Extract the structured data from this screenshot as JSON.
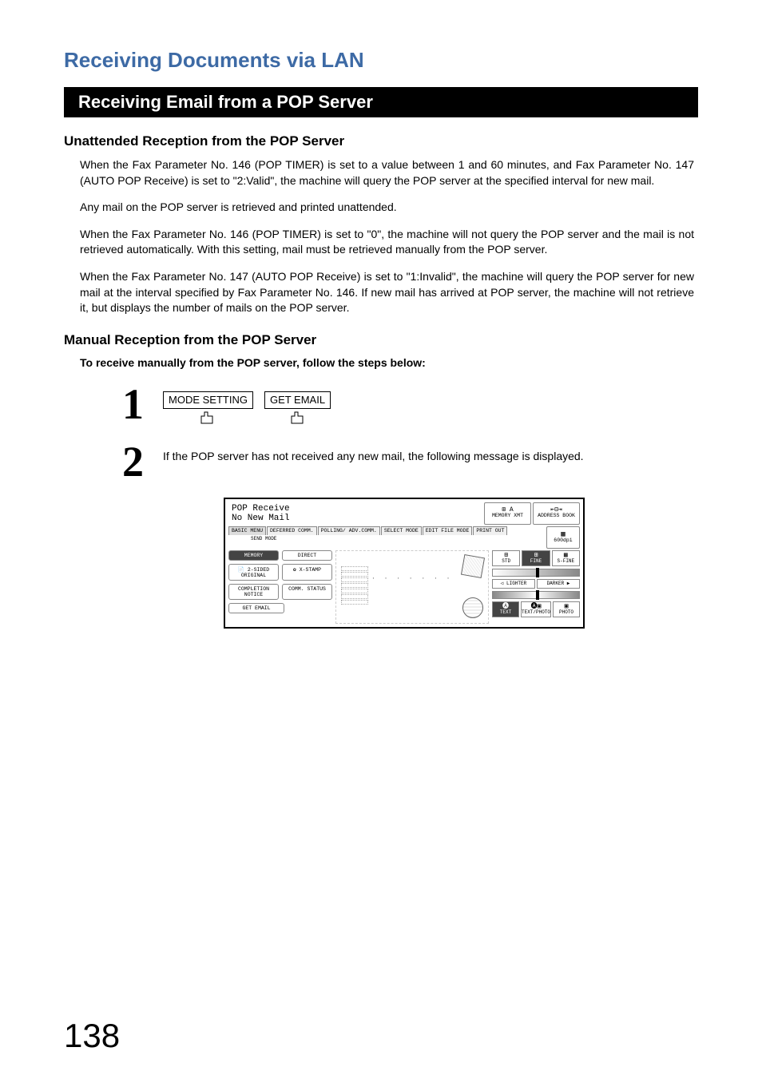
{
  "chapter_title": "Receiving Documents via LAN",
  "section_title": "Receiving Email from a POP Server",
  "sub1": {
    "heading": "Unattended Reception from the POP Server",
    "para1": "When the Fax Parameter No. 146 (POP TIMER) is set to a value between 1 and 60 minutes, and Fax Parameter No. 147 (AUTO POP Receive) is set to \"2:Valid\", the machine will query the POP server at the specified interval for new mail.",
    "para2": "Any mail on the POP server is retrieved and printed unattended.",
    "para3": "When the Fax Parameter No. 146 (POP TIMER) is set to \"0\", the machine will not query the POP server and the mail is not retrieved automatically.  With this setting, mail must be retrieved manually from the POP server.",
    "para4": "When the Fax Parameter No. 147 (AUTO POP Receive) is set to \"1:Invalid\", the machine will query the POP server for new mail at the interval specified by Fax Parameter No. 146.  If new mail has arrived at POP server, the machine will not retrieve it, but displays the number of mails on the POP server."
  },
  "sub2": {
    "heading": "Manual Reception from the POP Server",
    "instruction": "To receive manually from the POP server, follow the steps below:",
    "step1": {
      "num": "1",
      "btn1": "MODE SETTING",
      "btn2": "GET EMAIL"
    },
    "step2": {
      "num": "2",
      "text": "If the POP server has not received any new mail, the following message is displayed."
    }
  },
  "lcd": {
    "status_line1": "POP Receive",
    "status_line2": "No New Mail",
    "top_btn1": "MEMORY XMT",
    "top_btn2": "ADDRESS BOOK",
    "dpi": "600dpi",
    "tabs": [
      "BASIC MENU",
      "DEFERRED COMM.",
      "POLLING/ ADV.COMM.",
      "SELECT MODE",
      "EDIT FILE MODE",
      "PRINT OUT"
    ],
    "send_mode": "SEND MODE",
    "left": {
      "memory": "MEMORY",
      "direct": "DIRECT",
      "two_sided": "2-SIDED ORIGINAL",
      "xstamp": "X-STAMP",
      "completion": "COMPLETION NOTICE",
      "comm_status": "COMM. STATUS",
      "get_email": "GET EMAIL"
    },
    "right": {
      "res": {
        "std": "STD",
        "fine": "FINE",
        "sfine": "S-FINE"
      },
      "lighter": "LIGHTER",
      "darker": "DARKER",
      "mode": {
        "text": "TEXT",
        "textphoto": "TEXT/PHOTO",
        "photo": "PHOTO"
      }
    }
  },
  "page_number": "138"
}
